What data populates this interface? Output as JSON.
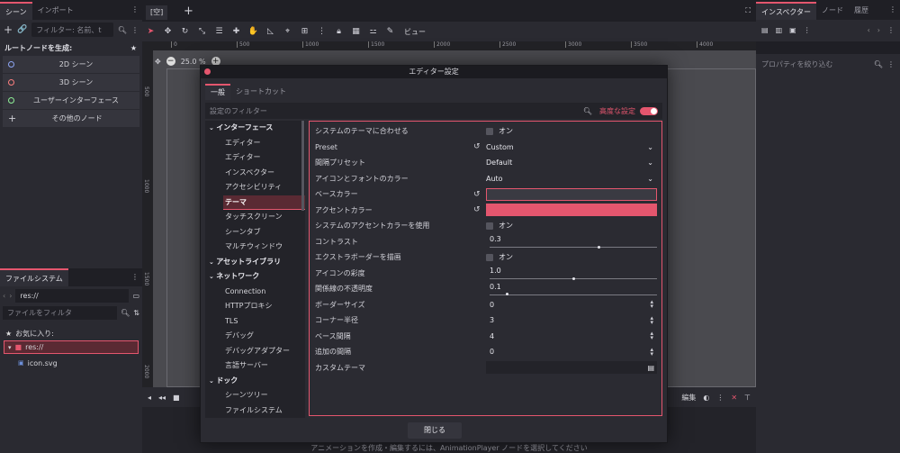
{
  "left_dock": {
    "tabs": [
      "シーン",
      "インポート"
    ],
    "filter_placeholder": "フィルター: 名前、t",
    "root_label": "ルートノードを生成:",
    "root_items": [
      {
        "label": "2D シーン",
        "color": "#8da5f3"
      },
      {
        "label": "3D シーン",
        "color": "#fc7f7f"
      },
      {
        "label": "ユーザーインターフェース",
        "color": "#8eef97"
      },
      {
        "label": "その他のノード",
        "color": ""
      }
    ],
    "fs_tab": "ファイルシステム",
    "fs_path": "res://",
    "fs_filter_placeholder": "ファイルをフィルタ",
    "favorites": "お気に入り:",
    "res_root": "res://",
    "file": "icon.svg"
  },
  "scene_tab": "[空]",
  "toolbar": {
    "view_label": "ビュー"
  },
  "zoom": "25.0 %",
  "ruler_ticks": [
    "0",
    "500",
    "1000",
    "1500",
    "2000",
    "2500",
    "3000",
    "3500",
    "4000",
    "4500",
    "5000"
  ],
  "ruler_left_ticks": [
    "500",
    "1000",
    "1500",
    "2000"
  ],
  "right_dock": {
    "tabs": [
      "インスペクター",
      "ノード",
      "履歴"
    ],
    "filter_placeholder": "プロパティを絞り込む"
  },
  "bottom": {
    "text": "アニメーションを作成・編集するには、AnimationPlayer ノードを選択してください",
    "edit_label": "編集"
  },
  "dialog": {
    "title": "エディター設定",
    "tabs": [
      "一般",
      "ショートカット"
    ],
    "filter_placeholder": "設定のフィルター",
    "advanced_label": "高度な設定",
    "close_label": "閉じる",
    "accent_color": "#e4566e",
    "categories": [
      {
        "label": "インターフェース",
        "level": 0,
        "bold": true
      },
      {
        "label": "エディター",
        "level": 1
      },
      {
        "label": "エディター",
        "level": 1
      },
      {
        "label": "インスペクター",
        "level": 1
      },
      {
        "label": "アクセシビリティ",
        "level": 1
      },
      {
        "label": "テーマ",
        "level": 1,
        "selected": true
      },
      {
        "label": "タッチスクリーン",
        "level": 1
      },
      {
        "label": "シーンタブ",
        "level": 1
      },
      {
        "label": "マルチウィンドウ",
        "level": 1
      },
      {
        "label": "アセットライブラリ",
        "level": 0,
        "bold": true
      },
      {
        "label": "ネットワーク",
        "level": 0,
        "bold": true
      },
      {
        "label": "Connection",
        "level": 1
      },
      {
        "label": "HTTPプロキシ",
        "level": 1
      },
      {
        "label": "TLS",
        "level": 1
      },
      {
        "label": "デバッグ",
        "level": 1
      },
      {
        "label": "デバッグアダプター",
        "level": 1
      },
      {
        "label": "言語サーバー",
        "level": 1
      },
      {
        "label": "ドック",
        "level": 0,
        "bold": true
      },
      {
        "label": "シーンツリー",
        "level": 1
      },
      {
        "label": "ファイルシステム",
        "level": 1
      }
    ],
    "props": [
      {
        "label": "システムのテーマに合わせる",
        "type": "check",
        "value": "オン"
      },
      {
        "label": "Preset",
        "type": "select",
        "value": "Custom",
        "revert": true
      },
      {
        "label": "間隔プリセット",
        "type": "select",
        "value": "Default"
      },
      {
        "label": "アイコンとフォントのカラー",
        "type": "select",
        "value": "Auto"
      },
      {
        "label": "ベースカラー",
        "type": "color",
        "value": "#3a3a42",
        "revert": true
      },
      {
        "label": "アクセントカラー",
        "type": "color",
        "value": "#e4566e",
        "revert": true
      },
      {
        "label": "システムのアクセントカラーを使用",
        "type": "check",
        "value": "オン"
      },
      {
        "label": "コントラスト",
        "type": "slider",
        "value": "0.3",
        "fraction": 0.65
      },
      {
        "label": "エクストラボーダーを描画",
        "type": "check",
        "value": "オン"
      },
      {
        "label": "アイコンの彩度",
        "type": "slider",
        "value": "1.0",
        "fraction": 0.5
      },
      {
        "label": "関係線の不透明度",
        "type": "slider",
        "value": "0.1",
        "fraction": 0.1
      },
      {
        "label": "ボーダーサイズ",
        "type": "spin",
        "value": "0"
      },
      {
        "label": "コーナー半径",
        "type": "spin",
        "value": "3"
      },
      {
        "label": "ベース間隔",
        "type": "spin",
        "value": "4"
      },
      {
        "label": "追加の間隔",
        "type": "spin",
        "value": "0"
      },
      {
        "label": "カスタムテーマ",
        "type": "file",
        "value": ""
      }
    ]
  }
}
